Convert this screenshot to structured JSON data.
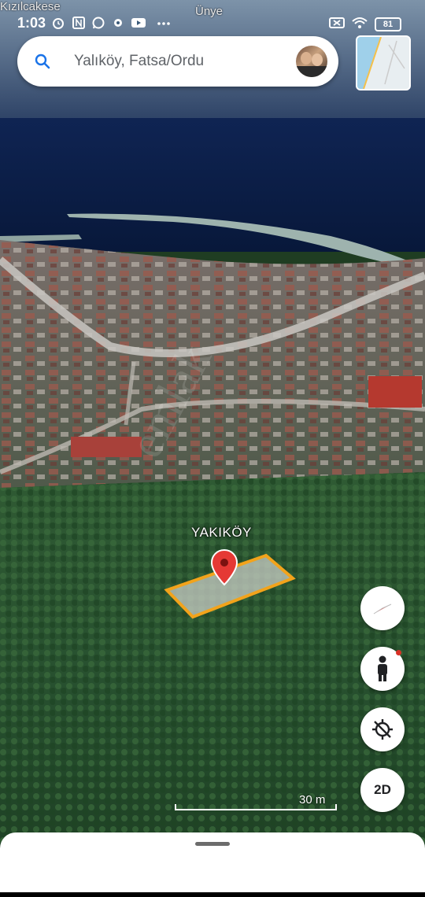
{
  "status_bar": {
    "top_place_left": "Kızılcakese",
    "top_place_center": "Ünye",
    "time": "1:03",
    "battery": "81",
    "icons": [
      "alarm-icon",
      "n-notification-icon",
      "whatsapp-icon",
      "gear-icon",
      "youtube-icon",
      "more-dots-icon",
      "screen-off-icon",
      "wifi-icon",
      "battery-icon"
    ]
  },
  "search": {
    "text": "Yalıköy, Fatsa/Ordu",
    "icon": "search-icon"
  },
  "map": {
    "place_label": "YAKIKÖY",
    "scale_label": "30 m",
    "watermark": "emlak",
    "colors": {
      "sea": "#0c1e47",
      "marker": "#e53935",
      "parcel_outline": "#f2a31b"
    }
  },
  "controls": {
    "compass": "compass-icon",
    "street_view": "pegman-icon",
    "location": "location-off-icon",
    "view_mode": "2D"
  }
}
